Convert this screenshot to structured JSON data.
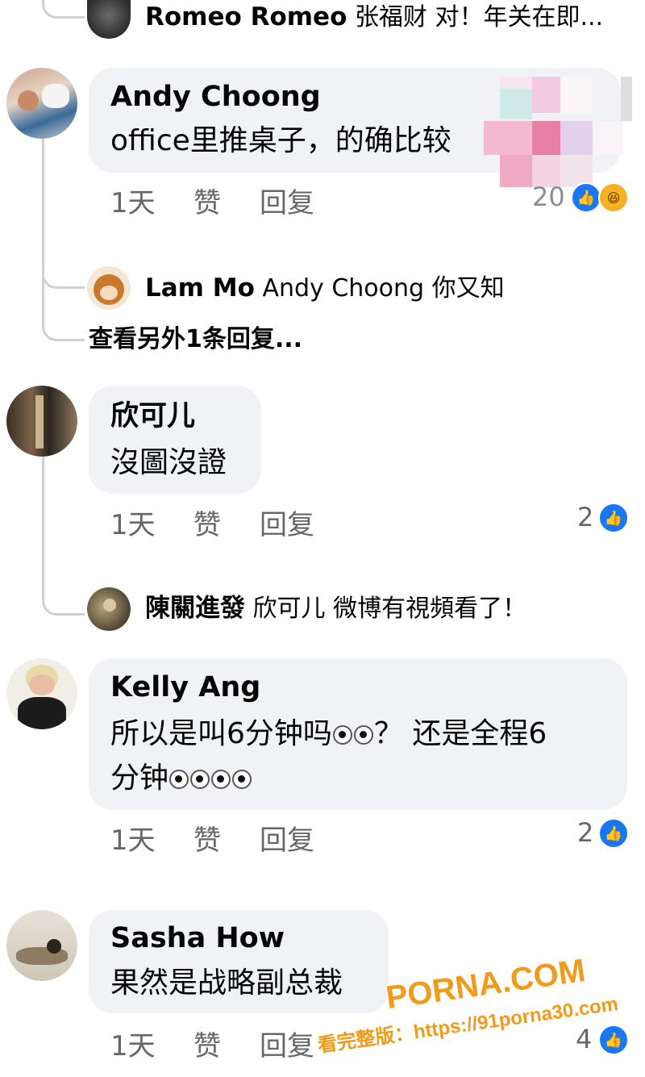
{
  "top_reply": {
    "name": "Romeo Romeo",
    "text": "张福财 对！年关在即..."
  },
  "comments": [
    {
      "name": "Andy Choong",
      "text_lines": [
        "office里推桌子，的确比较"
      ],
      "time": "1天",
      "like": "赞",
      "reply": "回复",
      "reaction_count": "20",
      "replies": [
        {
          "name": "Lam Mo",
          "text": "Andy Choong 你又知"
        }
      ],
      "more_replies": "查看另外1条回复..."
    },
    {
      "name": "欣可儿",
      "text_lines": [
        "沒圖沒證"
      ],
      "time": "1天",
      "like": "赞",
      "reply": "回复",
      "reaction_count": "2",
      "replies": [
        {
          "name": "陳關進發",
          "text": "欣可儿 微博有視頻看了！"
        }
      ]
    },
    {
      "name": "Kelly Ang",
      "text_lines": [
        "所以是叫6分钟吗",
        "？ 还是全程6",
        "分钟"
      ],
      "time": "1天",
      "like": "赞",
      "reply": "回复",
      "reaction_count": "2"
    },
    {
      "name": "Sasha How",
      "text_lines": [
        "果然是战略副总裁"
      ],
      "time": "1天",
      "like": "赞",
      "reply": "回复",
      "reaction_count": "4"
    }
  ],
  "watermark": {
    "logo": "PORNA.COM",
    "line": "看完整版：https://91porna30.com"
  },
  "icons": {
    "like": "like-icon",
    "haha": "haha-icon"
  },
  "colors": {
    "bubble": "#f0f2f5",
    "like_blue": "#1877f2",
    "meta_gray": "#65676b",
    "watermark_orange": "#f29a1a"
  }
}
